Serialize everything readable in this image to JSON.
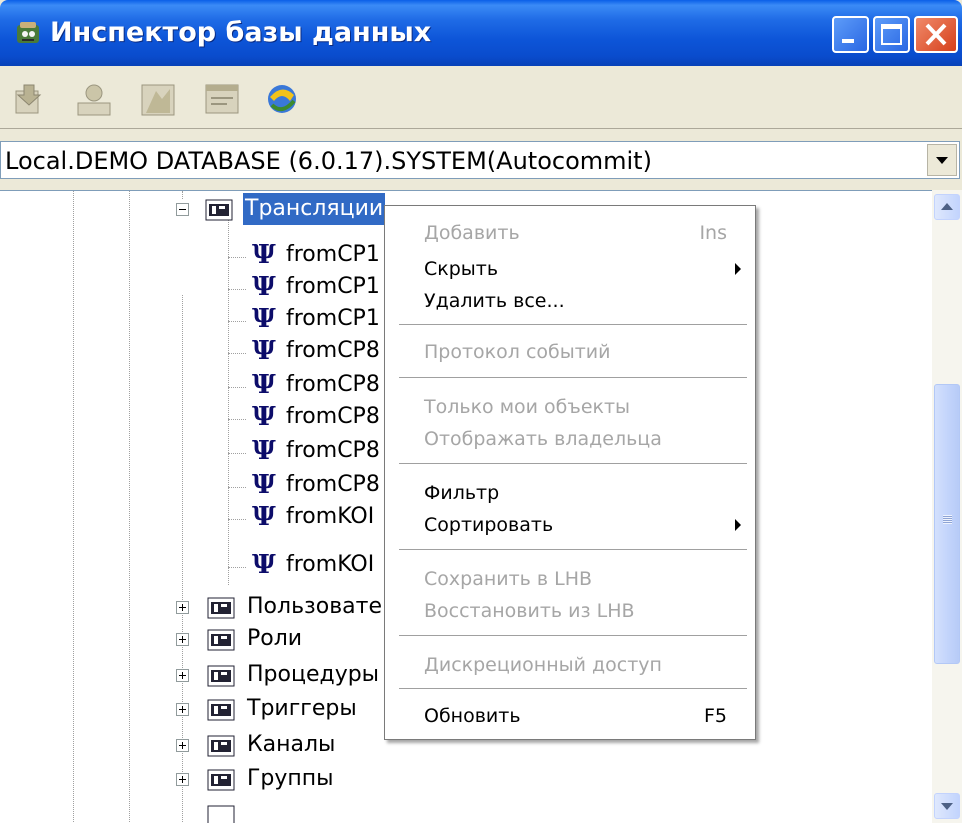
{
  "window": {
    "title": "Инспектор базы данных",
    "app_icon": "database-app-icon"
  },
  "toolbar": {
    "buttons": [
      {
        "name": "add-object-button",
        "icon": "add-object-icon"
      },
      {
        "name": "object-properties-button",
        "icon": "properties-icon"
      },
      {
        "name": "object-rights-button",
        "icon": "rights-icon"
      },
      {
        "name": "sql-window-button",
        "icon": "sql-window-icon"
      },
      {
        "name": "connect-button",
        "icon": "connect-icon"
      }
    ]
  },
  "connection": {
    "value": "Local.DEMO DATABASE (6.0.17).SYSTEM(Autocommit)"
  },
  "tree": {
    "selected": "Трансляции",
    "children": [
      "fromCP1",
      "fromCP1",
      "fromCP1",
      "fromCP8",
      "fromCP8",
      "fromCP8",
      "fromCP8",
      "fromCP8",
      "fromKOI",
      "fromKOI"
    ],
    "siblings": [
      "Пользовате",
      "Роли",
      "Процедуры",
      "Триггеры",
      "Каналы",
      "Группы"
    ]
  },
  "context_menu": {
    "items": [
      {
        "label": "Добавить",
        "shortcut": "Ins",
        "enabled": false
      },
      {
        "label": "Скрыть",
        "submenu": true,
        "enabled": true
      },
      {
        "label": "Удалить все...",
        "enabled": true
      },
      {
        "separator": true
      },
      {
        "label": "Протокол событий",
        "enabled": false
      },
      {
        "separator": true
      },
      {
        "label": "Только мои объекты",
        "enabled": false
      },
      {
        "label": "Отображать владельца",
        "enabled": false
      },
      {
        "separator": true
      },
      {
        "label": "Фильтр",
        "enabled": true
      },
      {
        "label": "Сортировать",
        "submenu": true,
        "enabled": true
      },
      {
        "separator": true
      },
      {
        "label": "Сохранить в LHB",
        "enabled": false
      },
      {
        "label": "Восстановить из LHB",
        "enabled": false
      },
      {
        "separator": true
      },
      {
        "label": "Дискреционный доступ",
        "enabled": false
      },
      {
        "separator": true
      },
      {
        "label": "Обновить",
        "shortcut": "F5",
        "enabled": true
      }
    ]
  },
  "colors": {
    "titlebar": "#0a5fe8",
    "selection": "#316ac5",
    "disabled_text": "#a6a6a6"
  }
}
